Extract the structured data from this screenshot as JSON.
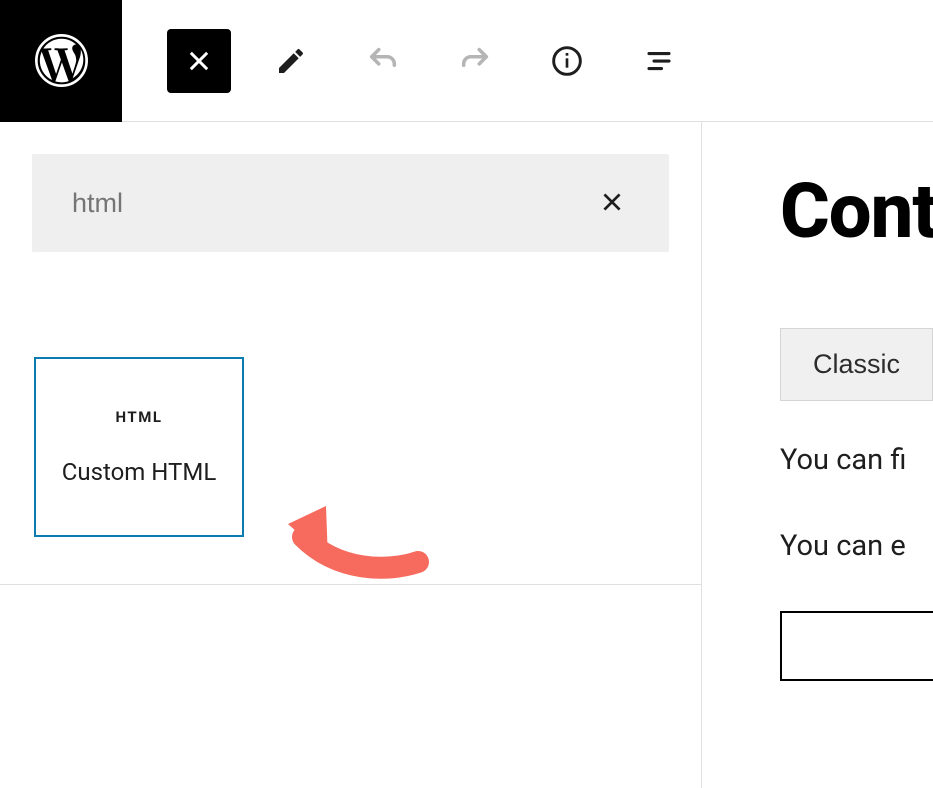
{
  "search": {
    "value": "html"
  },
  "block": {
    "icon_label": "HTML",
    "title": "Custom HTML"
  },
  "right": {
    "heading": "Cont",
    "classic_label": "Classic",
    "text1": "You can fi",
    "text2": "You can e"
  }
}
